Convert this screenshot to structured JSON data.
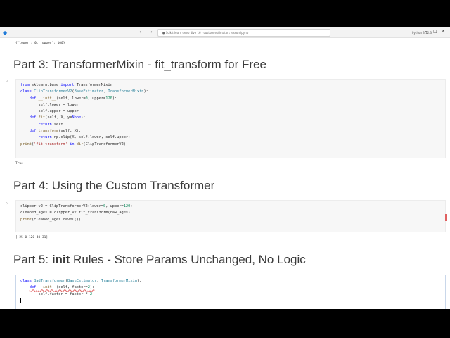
{
  "titlebar": {
    "search_text": "● Scikit-learn deep dive 16 - custom estimators lesson.ipynb",
    "kernel": "Python 3.12.3"
  },
  "outputs": {
    "dict_output": "{'lower': 0, 'upper': 100}",
    "true_output": "True",
    "array_output": "[ 25   0 120  40  31]"
  },
  "headings": {
    "part3": "Part 3: TransformerMixin - fit_transform for Free",
    "part4": "Part 4: Using the Custom Transformer",
    "part5_prefix": "Part 5: ",
    "part5_bold": "init",
    "part5_suffix": " Rules - Store Params Unchanged, No Logic"
  },
  "cells": {
    "cell1_lines": [
      "from sklearn.base import TransformerMixin",
      "class ClipTransformerV2(BaseEstimator, TransformerMixin):",
      "    def __init__(self, lower=0, upper=120):",
      "        self.lower = lower",
      "        self.upper = upper",
      "    def fit(self, X, y=None):",
      "        return self",
      "    def transform(self, X):",
      "        return np.clip(X, self.lower, self.upper)",
      "print('fit_transform' in dir(ClipTransformerV2))"
    ],
    "cell2_lines": [
      "clipper_v2 = ClipTransformerV2(lower=0, upper=120)",
      "cleaned_ages = clipper_v2.fit_transform(raw_ages)",
      "print(cleaned_ages.ravel())"
    ],
    "cell3_lines": [
      "class BadTransformer(BaseEstimator, TransformerMixin):",
      "    def __init__(self, factor=2):",
      "        self.factor = factor * 2",
      ""
    ]
  },
  "colors": {
    "keyword": "#0000ff",
    "class": "#267f99",
    "string": "#a31515",
    "number": "#098658"
  }
}
